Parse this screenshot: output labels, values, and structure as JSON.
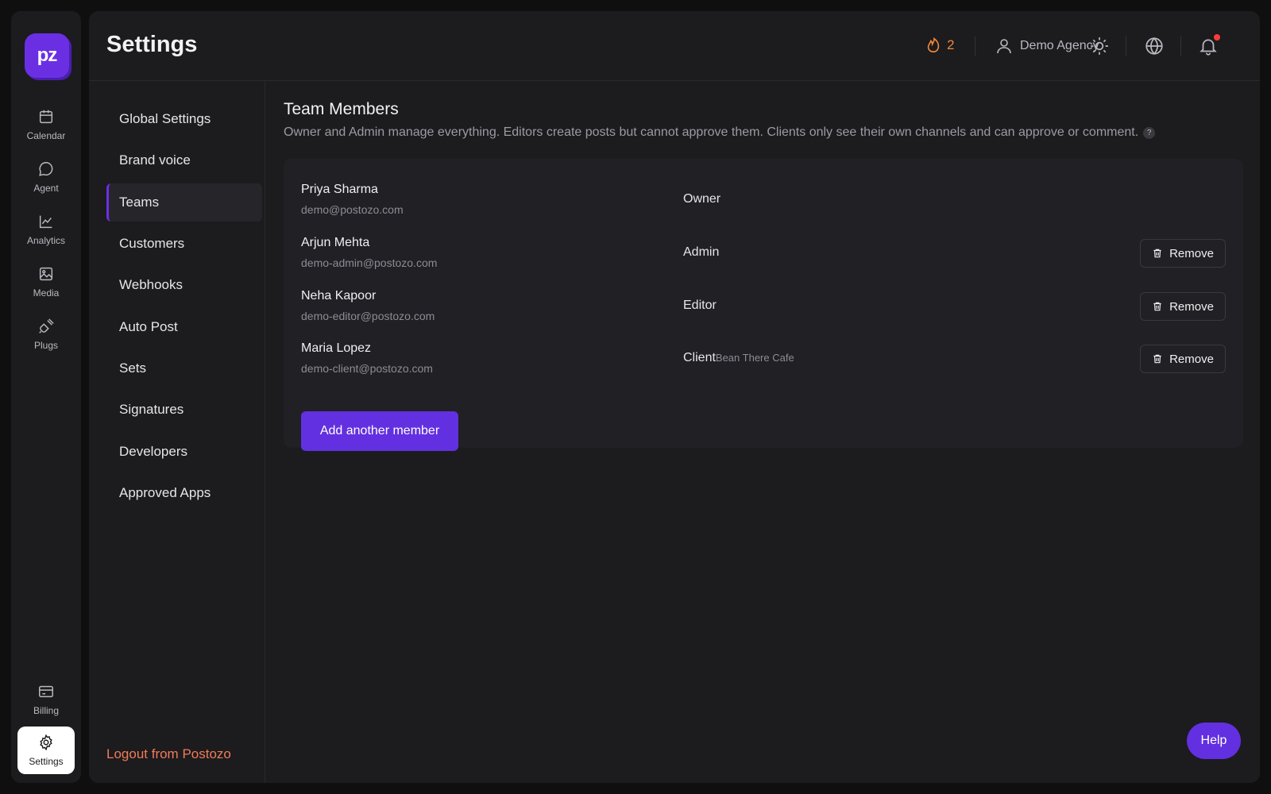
{
  "app": {
    "logo_text": "pz",
    "page_title": "Settings"
  },
  "rail": {
    "items": [
      {
        "label": "Calendar",
        "icon": "calendar-icon"
      },
      {
        "label": "Agent",
        "icon": "chat-bubble-icon"
      },
      {
        "label": "Analytics",
        "icon": "chart-line-icon"
      },
      {
        "label": "Media",
        "icon": "image-icon"
      },
      {
        "label": "Plugs",
        "icon": "plug-icon"
      }
    ],
    "bottom_items": [
      {
        "label": "Billing",
        "icon": "credit-card-icon"
      },
      {
        "label": "Settings",
        "icon": "gear-icon",
        "active": true
      }
    ]
  },
  "topbar": {
    "streak_count": "2",
    "user_label": "Demo Agency",
    "streak_color": "#f2883a",
    "notification_dot_color": "#ff3b3b"
  },
  "settings_nav": {
    "items": [
      {
        "label": "Global Settings"
      },
      {
        "label": "Brand voice"
      },
      {
        "label": "Teams",
        "active": true
      },
      {
        "label": "Customers"
      },
      {
        "label": "Webhooks"
      },
      {
        "label": "Auto Post"
      },
      {
        "label": "Sets"
      },
      {
        "label": "Signatures"
      },
      {
        "label": "Developers"
      },
      {
        "label": "Approved Apps"
      }
    ],
    "logout_label": "Logout from Postozo"
  },
  "team": {
    "title": "Team Members",
    "description": "Owner and Admin manage everything. Editors create posts but cannot approve them. Clients only see their own channels and can approve or comment.",
    "help_mark": "?",
    "members": [
      {
        "name": "Priya Sharma",
        "email": "demo@postozo.com",
        "role": "Owner",
        "client": "",
        "removable": false
      },
      {
        "name": "Arjun Mehta",
        "email": "demo-admin@postozo.com",
        "role": "Admin",
        "client": "",
        "removable": true
      },
      {
        "name": "Neha Kapoor",
        "email": "demo-editor@postozo.com",
        "role": "Editor",
        "client": "",
        "removable": true
      },
      {
        "name": "Maria Lopez",
        "email": "demo-client@postozo.com",
        "role": "Client",
        "client": "Bean There Cafe",
        "removable": true
      }
    ],
    "remove_label": "Remove",
    "add_label": "Add another member"
  },
  "help_label": "Help",
  "accent_color": "#6230e0"
}
